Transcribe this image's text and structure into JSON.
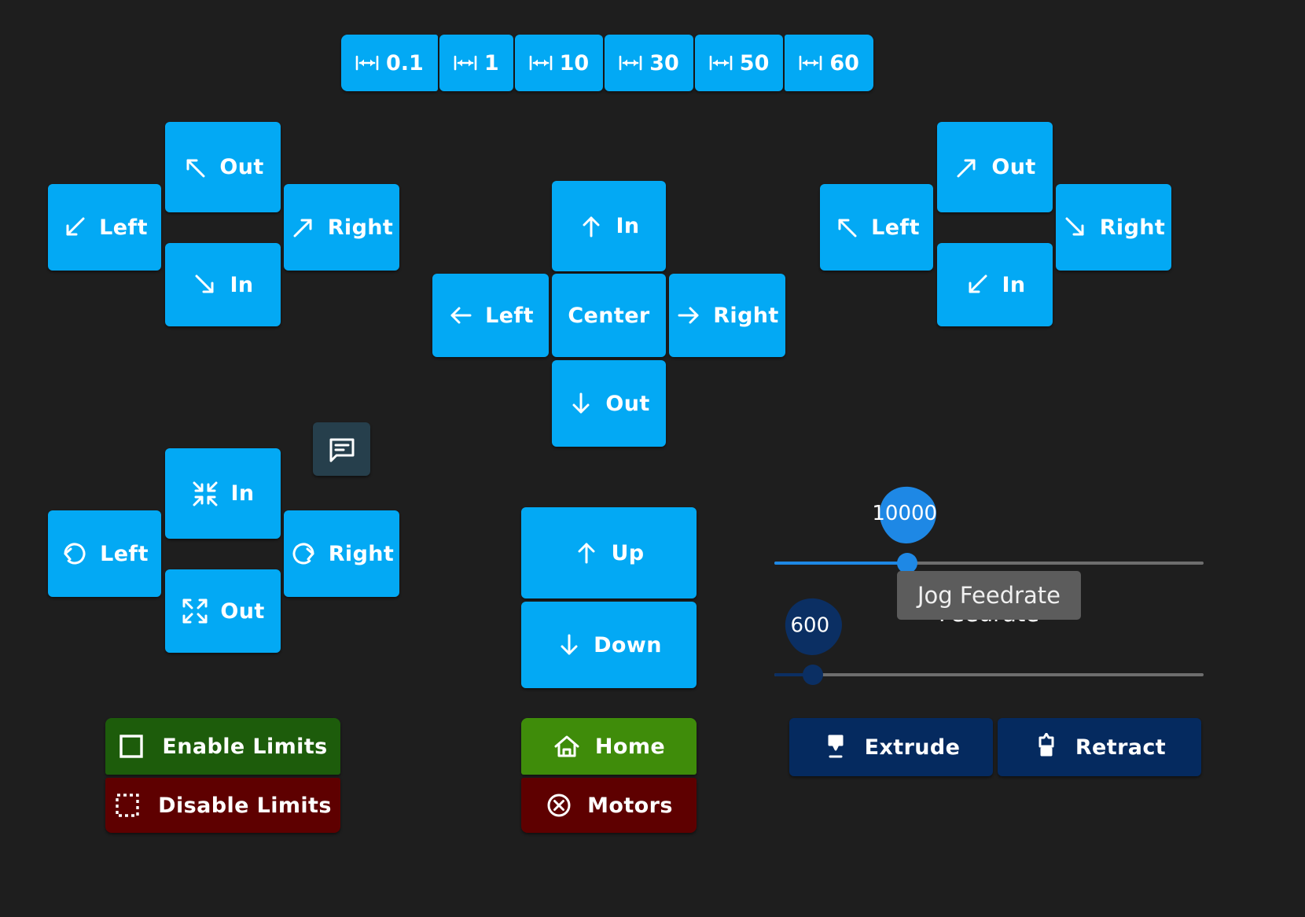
{
  "theme": {
    "background": "#1e1e1e",
    "accent_blue": "#03a9f4",
    "pin_blue": "#1e88e5",
    "pin_navy": "#0b2f63",
    "green_dark": "#1d5c0b",
    "green": "#3f8c0a",
    "red": "#5e0000",
    "navy": "#052a5f",
    "slate": "#263f4c",
    "tooltip_bg": "#5c5c5c"
  },
  "distance_bar": {
    "name": "jog-distance-selector",
    "icon": "horizontal-resize-icon",
    "options": [
      "0.1",
      "1",
      "10",
      "30",
      "50",
      "60"
    ]
  },
  "pad_left": {
    "name": "diagonal-jog-pad-left",
    "up": {
      "label": "Out",
      "icon": "arrow-up-left-icon"
    },
    "left": {
      "label": "Left",
      "icon": "arrow-down-left-icon"
    },
    "right": {
      "label": "Right",
      "icon": "arrow-up-right-icon"
    },
    "down": {
      "label": "In",
      "icon": "arrow-down-right-icon"
    }
  },
  "pad_center": {
    "name": "cardinal-jog-pad",
    "up": {
      "label": "In",
      "icon": "arrow-up-icon"
    },
    "left": {
      "label": "Left",
      "icon": "arrow-left-icon"
    },
    "center": {
      "label": "Center",
      "icon": "none"
    },
    "right": {
      "label": "Right",
      "icon": "arrow-right-icon"
    },
    "down": {
      "label": "Out",
      "icon": "arrow-down-icon"
    }
  },
  "pad_right": {
    "name": "diagonal-jog-pad-right",
    "up": {
      "label": "Out",
      "icon": "arrow-up-right-icon"
    },
    "left": {
      "label": "Left",
      "icon": "arrow-up-left-icon"
    },
    "right": {
      "label": "Right",
      "icon": "arrow-down-right-icon"
    },
    "down": {
      "label": "In",
      "icon": "arrow-down-left-icon"
    }
  },
  "pad_rotate": {
    "name": "rotate-zoom-pad",
    "up": {
      "label": "In",
      "icon": "collapse-arrows-icon"
    },
    "left": {
      "label": "Left",
      "icon": "rotate-counterclockwise-icon"
    },
    "right": {
      "label": "Right",
      "icon": "rotate-clockwise-icon"
    },
    "down": {
      "label": "Out",
      "icon": "expand-arrows-icon"
    }
  },
  "comment_button": {
    "name": "comment-button",
    "icon": "comment-icon"
  },
  "vertical_pad": {
    "up": {
      "label": "Up",
      "icon": "arrow-up-icon"
    },
    "down": {
      "label": "Down",
      "icon": "arrow-down-icon"
    }
  },
  "limits": {
    "enable": {
      "label": "Enable Limits",
      "icon": "square-solid-outline-icon"
    },
    "disable": {
      "label": "Disable Limits",
      "icon": "square-dashed-icon"
    }
  },
  "machine": {
    "home": {
      "label": "Home",
      "icon": "home-icon"
    },
    "motors": {
      "label": "Motors",
      "icon": "circle-x-icon"
    }
  },
  "extruder": {
    "extrude": {
      "label": "Extrude",
      "icon": "extrude-down-icon"
    },
    "retract": {
      "label": "Retract",
      "icon": "retract-up-icon"
    }
  },
  "sliders": {
    "jog_feedrate": {
      "name": "jog-feedrate-slider",
      "value": "10000",
      "label": "Jog Feedrate",
      "fill_percent": 31
    },
    "feedrate": {
      "name": "feedrate-slider",
      "value": "600",
      "label": "Feedrate",
      "fill_percent": 9
    }
  },
  "tooltip": {
    "text": "Jog Feedrate"
  }
}
